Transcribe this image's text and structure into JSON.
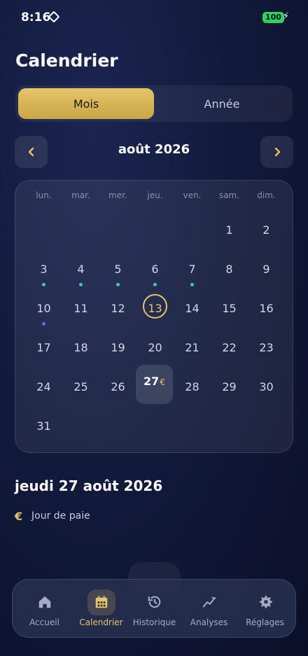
{
  "status": {
    "time": "8:16",
    "battery": "100",
    "bolt_icon": "bolt-icon"
  },
  "header": {
    "title": "Calendrier"
  },
  "segmented": {
    "month_label": "Mois",
    "year_label": "Année",
    "selected": "Mois"
  },
  "nav": {
    "month_title": "août 2026",
    "prev_icon": "chevron-left-icon",
    "next_icon": "chevron-right-icon"
  },
  "calendar": {
    "weekdays": [
      "lun.",
      "mar.",
      "mer.",
      "jeu.",
      "ven.",
      "sam.",
      "dim."
    ],
    "days": [
      "1",
      "2",
      "3",
      "4",
      "5",
      "6",
      "7",
      "8",
      "9",
      "10",
      "11",
      "12",
      "13",
      "14",
      "15",
      "16",
      "17",
      "18",
      "19",
      "20",
      "21",
      "22",
      "23",
      "24",
      "25",
      "26",
      "27",
      "28",
      "29",
      "30",
      "31"
    ],
    "today": "13",
    "selected": "27",
    "selected_marker": "€"
  },
  "detail": {
    "date": "jeudi 27 août 2026",
    "event_icon": "€",
    "event_label": "Jour de paie"
  },
  "tabbar": {
    "items": [
      {
        "label": "Accueil",
        "icon": "home-icon"
      },
      {
        "label": "Calendrier",
        "icon": "calendar-icon",
        "active": true
      },
      {
        "label": "Historique",
        "icon": "history-icon"
      },
      {
        "label": "Analyses",
        "icon": "analytics-icon"
      },
      {
        "label": "Réglages",
        "icon": "gear-icon"
      }
    ]
  },
  "colors": {
    "accent": "#e6c468",
    "background": "#121a3c",
    "teal_dot": "#4dc4a9",
    "blue_dot": "#5b6ff0"
  }
}
